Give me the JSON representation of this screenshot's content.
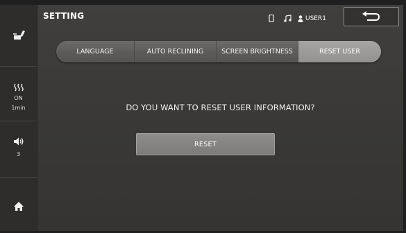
{
  "header": {
    "title": "SETTING",
    "user_label": "USER1"
  },
  "icons": {
    "seat": "seat-icon",
    "heater": "heater-icon",
    "volume": "volume-icon",
    "home": "home-icon",
    "phone": "phone-icon",
    "music": "music-note-icon",
    "user": "user-icon",
    "back": "back-arrow-icon"
  },
  "sidebar": {
    "heater": {
      "state": "ON",
      "duration": "1min"
    },
    "volume": {
      "level": "3"
    }
  },
  "tabs": [
    {
      "label": "LANGUAGE",
      "active": false
    },
    {
      "label": "AUTO RECLINING",
      "active": false
    },
    {
      "label": "SCREEN BRIGHTNESS",
      "active": false
    },
    {
      "label": "RESET USER",
      "active": true
    }
  ],
  "content": {
    "question": "DO YOU WANT TO RESET USER INFORMATION?",
    "reset_label": "RESET"
  }
}
